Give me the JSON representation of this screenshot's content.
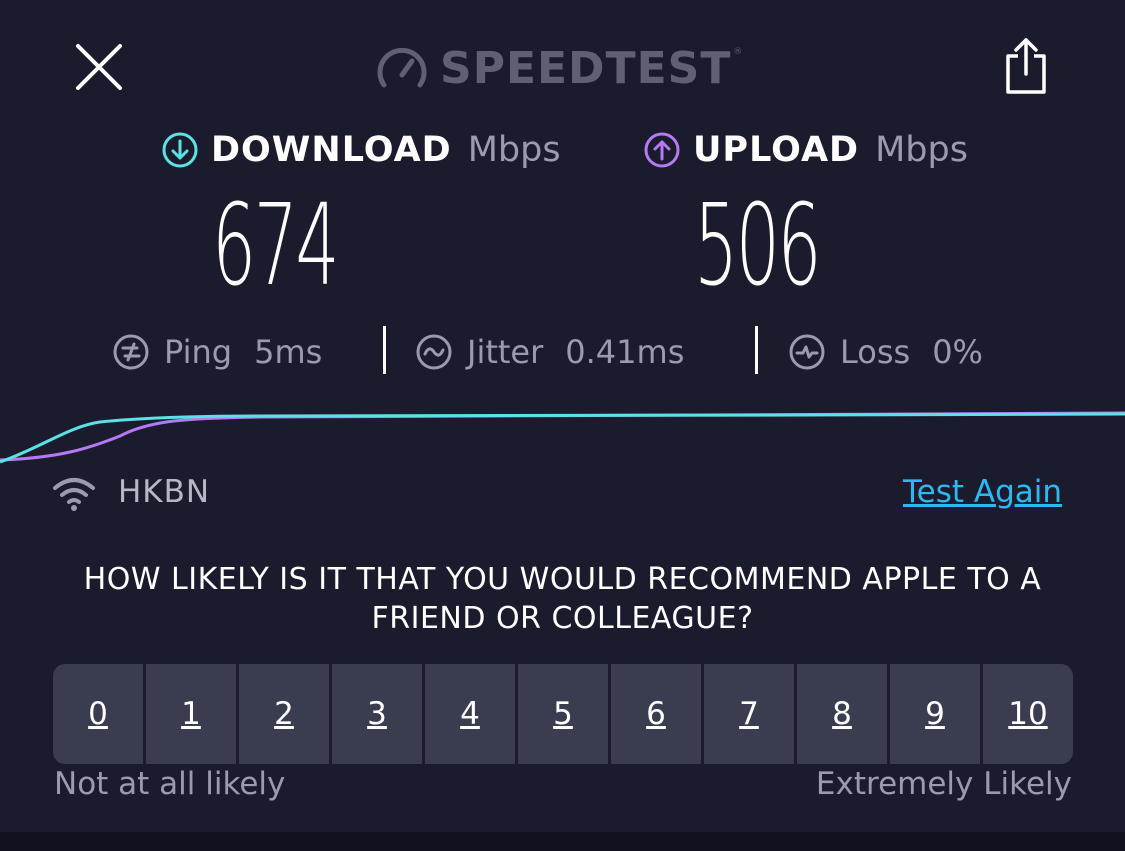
{
  "header": {
    "brand": "SPEEDTEST",
    "brand_mark": "®"
  },
  "download": {
    "label": "DOWNLOAD",
    "unit": "Mbps",
    "value": "674",
    "color": "#5ce1e6"
  },
  "upload": {
    "label": "UPLOAD",
    "unit": "Mbps",
    "value": "506",
    "color": "#b57af2"
  },
  "stats": {
    "ping_label": "Ping",
    "ping_value": "5ms",
    "jitter_label": "Jitter",
    "jitter_value": "0.41ms",
    "loss_label": "Loss",
    "loss_value": "0%"
  },
  "network": {
    "isp": "HKBN",
    "test_again": "Test Again"
  },
  "survey": {
    "question": "HOW LIKELY IS IT THAT YOU WOULD RECOMMEND APPLE TO A FRIEND OR COLLEAGUE?",
    "options": [
      "0",
      "1",
      "2",
      "3",
      "4",
      "5",
      "6",
      "7",
      "8",
      "9",
      "10"
    ],
    "low_label": "Not at all likely",
    "high_label": "Extremely Likely"
  },
  "icons": {
    "close": "close-icon",
    "share": "share-icon",
    "gauge": "gauge-icon",
    "download": "download-arrow-icon",
    "upload": "upload-arrow-icon",
    "ping": "ping-icon",
    "jitter": "jitter-icon",
    "loss": "loss-icon",
    "wifi": "wifi-icon"
  },
  "colors": {
    "background": "#1b1b2e",
    "accent_link": "#2fb7f2"
  }
}
